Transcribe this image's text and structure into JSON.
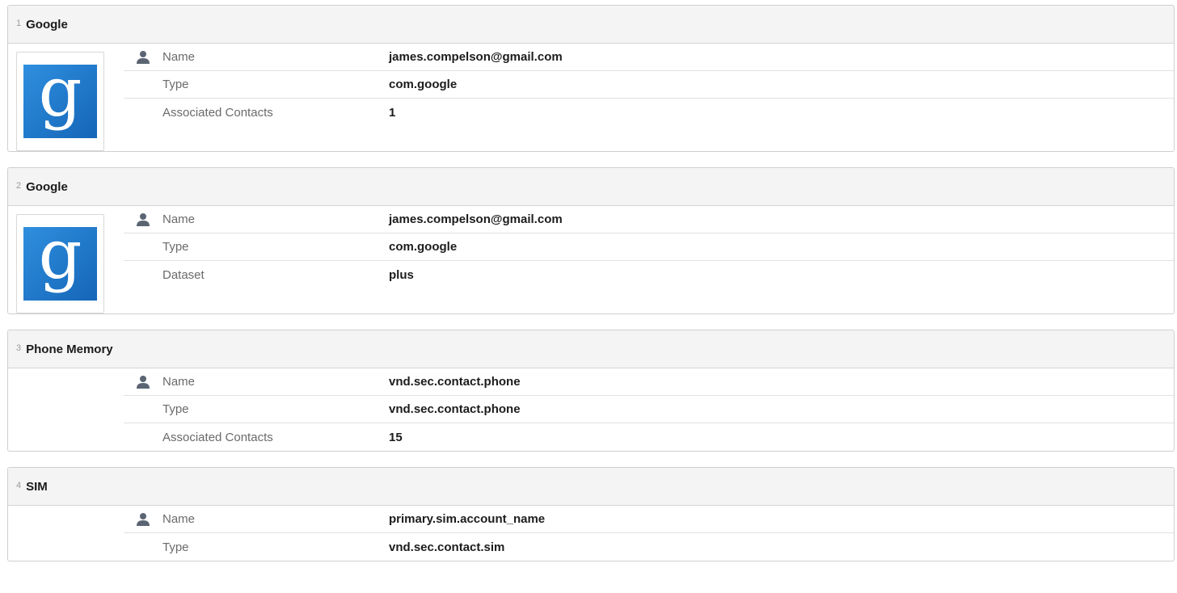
{
  "accounts": [
    {
      "index": "1",
      "title": "Google",
      "icon": "google-g-logo",
      "logo_glyph": "g",
      "fields": [
        {
          "label": "Name",
          "value": "james.compelson@gmail.com"
        },
        {
          "label": "Type",
          "value": "com.google"
        },
        {
          "label": "Associated Contacts",
          "value": "1"
        }
      ]
    },
    {
      "index": "2",
      "title": "Google",
      "icon": "google-g-logo",
      "logo_glyph": "g",
      "fields": [
        {
          "label": "Name",
          "value": "james.compelson@gmail.com"
        },
        {
          "label": "Type",
          "value": "com.google"
        },
        {
          "label": "Dataset",
          "value": "plus"
        }
      ]
    },
    {
      "index": "3",
      "title": "Phone Memory",
      "fields": [
        {
          "label": "Name",
          "value": "vnd.sec.contact.phone"
        },
        {
          "label": "Type",
          "value": "vnd.sec.contact.phone"
        },
        {
          "label": "Associated Contacts",
          "value": "15"
        }
      ]
    },
    {
      "index": "4",
      "title": "SIM",
      "fields": [
        {
          "label": "Name",
          "value": "primary.sim.account_name"
        },
        {
          "label": "Type",
          "value": "vnd.sec.contact.sim"
        }
      ]
    }
  ],
  "colors": {
    "header_bg": "#f4f4f4",
    "border": "#cfcfcf",
    "label_text": "#6a6a6a",
    "value_text": "#1c1c1c",
    "person_icon": "#5a6472",
    "google_blue": "#1e78cc"
  }
}
